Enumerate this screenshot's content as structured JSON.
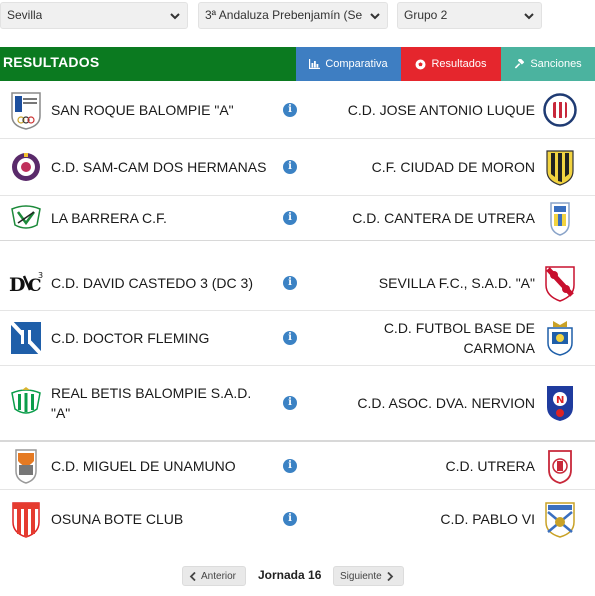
{
  "filters": {
    "region": "Sevilla",
    "category": "3ª Andaluza Prebenjamín (Se",
    "group": "Grupo 2"
  },
  "header": {
    "title": "RESULTADOS",
    "tabs": {
      "comparativa": "Comparativa",
      "resultados": "Resultados",
      "sanciones": "Sanciones"
    },
    "colors": {
      "bar": "#0b7a20",
      "comparativa": "#3e7ec2",
      "resultados": "#e5262d",
      "sanciones": "#4bb39f"
    }
  },
  "matches": [
    {
      "home": "SAN ROQUE BALOMPIE \"A\"",
      "away": "C.D. JOSE ANTONIO LUQUE",
      "home_crest": "san-roque-crest",
      "away_crest": "jose-antonio-luque-crest"
    },
    {
      "home": "C.D. SAM-CAM DOS HERMANAS",
      "away": "C.F. CIUDAD DE MORON",
      "home_crest": "sam-cam-crest",
      "away_crest": "ciudad-de-moron-crest"
    },
    {
      "home": "LA BARRERA C.F.",
      "away": "C.D. CANTERA DE UTRERA",
      "home_crest": "la-barrera-crest",
      "away_crest": "cantera-utrera-crest"
    },
    {
      "home": "C.D. DAVID CASTEDO 3 (DC 3)",
      "away": "SEVILLA F.C., S.A.D. \"A\"",
      "home_crest": "dc3-crest",
      "away_crest": "sevilla-fc-crest"
    },
    {
      "home": "C.D. DOCTOR FLEMING",
      "away": "C.D. FUTBOL BASE DE CARMONA",
      "home_crest": "doctor-fleming-crest",
      "away_crest": "carmona-crest"
    },
    {
      "home": "REAL BETIS BALOMPIE S.A.D. \"A\"",
      "away": "C.D. ASOC. DVA. NERVION",
      "home_crest": "betis-crest",
      "away_crest": "nervion-crest"
    },
    {
      "home": "C.D. MIGUEL DE UNAMUNO",
      "away": "C.D. UTRERA",
      "home_crest": "unamuno-crest",
      "away_crest": "utrera-crest"
    },
    {
      "home": "OSUNA BOTE CLUB",
      "away": "C.D. PABLO VI",
      "home_crest": "osuna-crest",
      "away_crest": "pablo-vi-crest"
    }
  ],
  "info_icon": "i",
  "pager": {
    "prev": "Anterior",
    "current": "Jornada 16",
    "next": "Siguiente"
  }
}
